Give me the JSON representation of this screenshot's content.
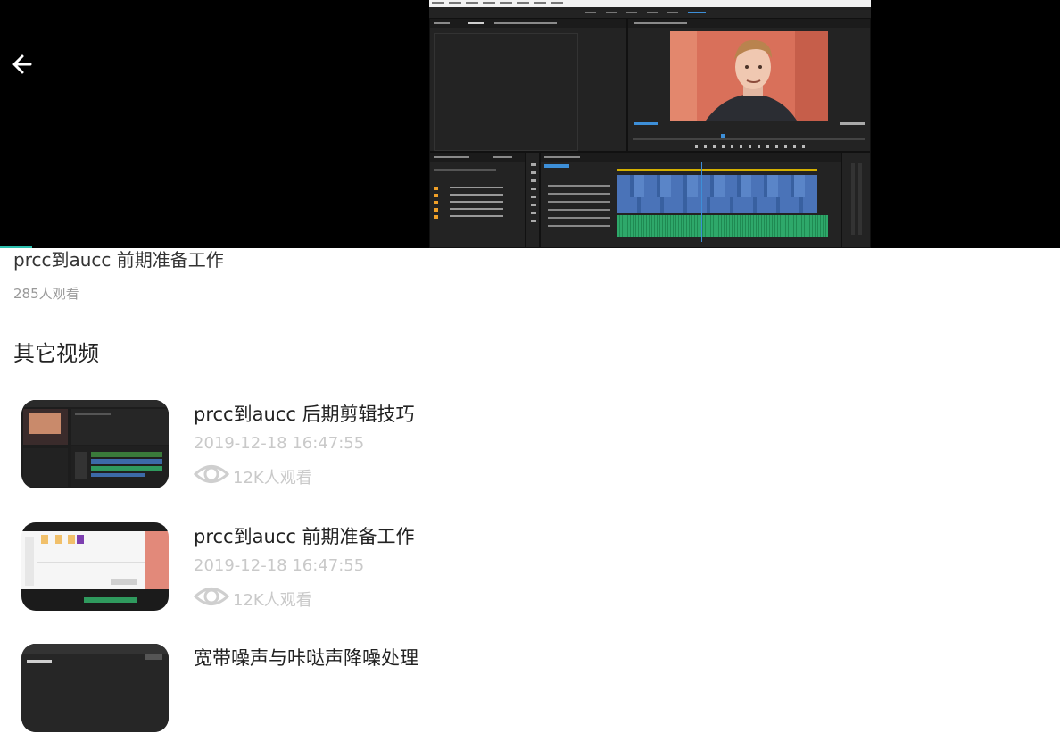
{
  "player": {
    "back_icon": "arrow-left-icon",
    "frame_description_icon": "video-frame"
  },
  "current": {
    "title": "prcc到aucc 前期准备工作",
    "views": "285人观看"
  },
  "section_title": "其它视频",
  "videos": [
    {
      "title": "prcc到aucc 后期剪辑技巧",
      "date": "2019-12-18 16:47:55",
      "views": "12K人观看"
    },
    {
      "title": "prcc到aucc 前期准备工作",
      "date": "2019-12-18 16:47:55",
      "views": "12K人观看"
    },
    {
      "title": "宽带噪声与咔哒声降噪处理",
      "date": "",
      "views": ""
    }
  ],
  "colors": {
    "accent": "#2bbfae",
    "muted": "#c9c9c9",
    "text": "#222222"
  }
}
